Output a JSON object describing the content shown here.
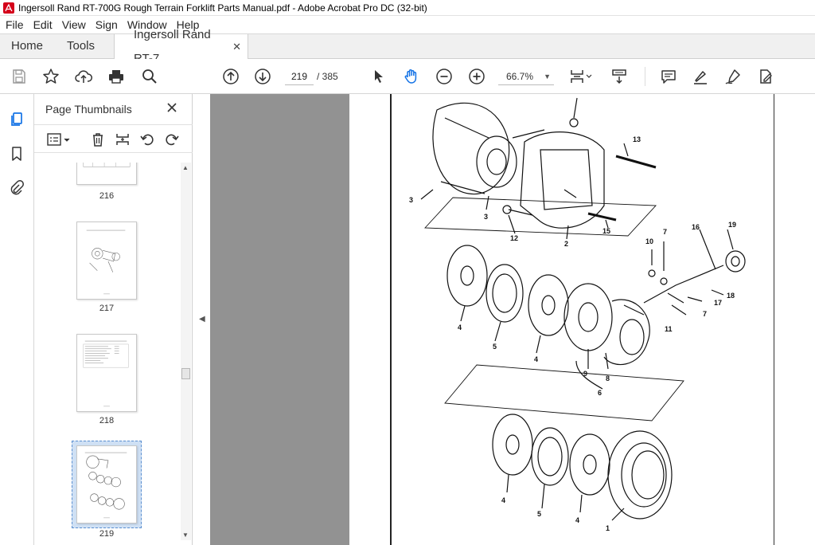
{
  "window": {
    "title": "Ingersoll Rand RT-700G Rough Terrain Forklift Parts Manual.pdf - Adobe Acrobat Pro DC (32-bit)"
  },
  "menu": {
    "items": [
      "File",
      "Edit",
      "View",
      "Sign",
      "Window",
      "Help"
    ]
  },
  "tabs": {
    "home": "Home",
    "tools": "Tools",
    "document": "Ingersoll Rand RT-7...",
    "close_glyph": "✕"
  },
  "toolbar": {
    "page_current": "219",
    "page_total": "/ 385",
    "zoom": "66.7%",
    "icons": [
      "save-icon",
      "bookmark-star-icon",
      "upload-cloud-icon",
      "print-icon",
      "search-zoom-icon",
      "prev-page-icon",
      "next-page-icon",
      "select-cursor-icon",
      "hand-tool-icon",
      "zoom-out-icon",
      "zoom-in-icon",
      "page-fit-icon",
      "scroll-mode-icon",
      "comment-icon",
      "highlight-pen-icon",
      "sign-pen-icon",
      "edit-pdf-icon"
    ]
  },
  "sidebar": {
    "icons": [
      "page-thumbnails-icon",
      "bookmarks-icon",
      "attachments-icon"
    ]
  },
  "thumb_panel": {
    "title": "Page Thumbnails",
    "close_glyph": "✕",
    "thumbnails": [
      {
        "label": "216"
      },
      {
        "label": "217"
      },
      {
        "label": "218"
      },
      {
        "label": "219",
        "selected": true
      }
    ]
  },
  "document": {
    "callouts": [
      "3",
      "3",
      "12",
      "2",
      "15",
      "13",
      "4",
      "5",
      "4",
      "10",
      "7",
      "16",
      "19",
      "18",
      "17",
      "7",
      "11",
      "9",
      "8",
      "6",
      "4",
      "5",
      "4",
      "1"
    ]
  },
  "colors": {
    "accent": "#1473e6",
    "doc_background": "#929292",
    "selection": "#cfe0f4"
  }
}
